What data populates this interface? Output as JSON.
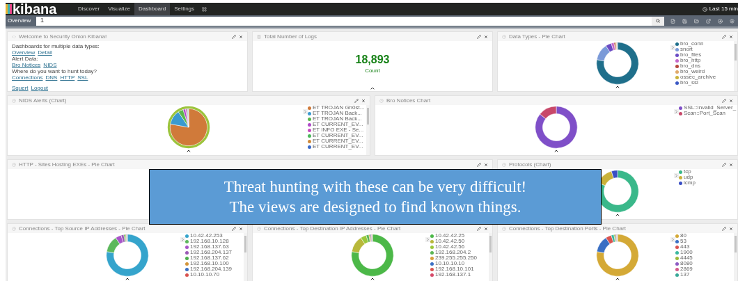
{
  "navbar": {
    "logo": "kibana",
    "tabs": [
      {
        "label": "Discover",
        "selected": false
      },
      {
        "label": "Visualize",
        "selected": false
      },
      {
        "label": "Dashboard",
        "selected": true
      },
      {
        "label": "Settings",
        "selected": false
      }
    ],
    "time": "Last 15 min"
  },
  "query_bar": {
    "tab": "Overview",
    "value": "1"
  },
  "rows": [
    {
      "panels": [
        {
          "kind": "markdown",
          "title": "Welcome to Security Onion Kibana!",
          "lines": [
            {
              "kind": "text",
              "parts": [
                "Dashboards for multiple data types:"
              ]
            },
            {
              "kind": "links",
              "parts": [
                "Overview",
                "Detail"
              ]
            },
            {
              "kind": "text",
              "parts": [
                "Alert Data:"
              ]
            },
            {
              "kind": "links",
              "parts": [
                "Bro Notices",
                "NIDS"
              ]
            },
            {
              "kind": "text",
              "parts": [
                "Where do you want to hunt today?"
              ]
            },
            {
              "kind": "links",
              "parts": [
                "Connections",
                "DNS",
                "HTTP",
                "SSL"
              ]
            },
            {
              "kind": "gap"
            },
            {
              "kind": "links",
              "parts": [
                "Squert",
                "Logout"
              ]
            }
          ]
        },
        {
          "kind": "metric",
          "title": "Total Number of Logs",
          "value": "18,893",
          "label": "Count"
        },
        {
          "kind": "donut",
          "title": "Data Types - Pie Chart",
          "legend": [
            {
              "label": "bro_conn",
              "color": "#1f6f8b"
            },
            {
              "label": "snort",
              "color": "#7b9ad8"
            },
            {
              "label": "bro_files",
              "color": "#6a4bc4"
            },
            {
              "label": "bro_http",
              "color": "#c566c9"
            },
            {
              "label": "bro_dns",
              "color": "#b5483a"
            },
            {
              "label": "bro_weird",
              "color": "#e0a96a"
            },
            {
              "label": "ossec_archive",
              "color": "#c9b23a"
            },
            {
              "label": "bro_ssl",
              "color": "#3a58c4"
            }
          ]
        }
      ]
    },
    {
      "panels": [
        {
          "kind": "pie",
          "title": "NIDS Alerts (Chart)",
          "legend": [
            {
              "label": "ET TROJAN Gh0st...",
              "color": "#d07a3a"
            },
            {
              "label": "ET TROJAN Back...",
              "color": "#3a9ad0"
            },
            {
              "label": "ET TROJAN Back...",
              "color": "#5ab84a"
            },
            {
              "label": "ET CURRENT_EV...",
              "color": "#b04ac8"
            },
            {
              "label": "ET INFO EXE - Se...",
              "color": "#c84ac0"
            },
            {
              "label": "ET CURRENT_EV...",
              "color": "#4ab85a"
            },
            {
              "label": "ET CURRENT_EV...",
              "color": "#d08a3a"
            },
            {
              "label": "ET CURRENT_EV...",
              "color": "#3a6ac8"
            }
          ]
        },
        {
          "kind": "donut",
          "title": "Bro Notices Chart",
          "legend": [
            {
              "label": "SSL::Invalid_Server_",
              "color": "#7f4fc8"
            },
            {
              "label": "Scan::Port_Scan",
              "color": "#c8486a"
            }
          ]
        }
      ]
    },
    {
      "panels": [
        {
          "kind": "empty",
          "title": "HTTP - Sites Hosting EXEs - Pie Chart"
        },
        {
          "kind": "donut",
          "title": "Protocols (Chart)",
          "legend": [
            {
              "label": "tcp",
              "color": "#3ab88a"
            },
            {
              "label": "udp",
              "color": "#c9b23a"
            },
            {
              "label": "icmp",
              "color": "#3a4fc4"
            }
          ]
        }
      ]
    },
    {
      "panels": [
        {
          "kind": "donut",
          "title": "Connections - Top Source IP Addresses - Pie Chart",
          "legend": [
            {
              "label": "10.42.42.253",
              "color": "#35a4cc"
            },
            {
              "label": "192.168.10.128",
              "color": "#5cb85c"
            },
            {
              "label": "192.168.137.63",
              "color": "#a855c8"
            },
            {
              "label": "192.168.204.137",
              "color": "#9b59b6"
            },
            {
              "label": "192.168.137.62",
              "color": "#4cae4c"
            },
            {
              "label": "192.168.10.100",
              "color": "#d4953a"
            },
            {
              "label": "192.168.204.139",
              "color": "#3a6fc4"
            },
            {
              "label": "10.10.10.70",
              "color": "#d9534f"
            }
          ]
        },
        {
          "kind": "donut",
          "title": "Connections - Top Destination IP Addresses - Pie Chart",
          "legend": [
            {
              "label": "10.42.42.25",
              "color": "#4cb848"
            },
            {
              "label": "10.42.42.50",
              "color": "#b8b83a"
            },
            {
              "label": "10.42.42.56",
              "color": "#9ac83a"
            },
            {
              "label": "192.168.204.2",
              "color": "#5ab552"
            },
            {
              "label": "239.255.255.250",
              "color": "#d69e3a"
            },
            {
              "label": "10.10.10.10",
              "color": "#3a6fc4"
            },
            {
              "label": "192.168.10.101",
              "color": "#d9534f"
            },
            {
              "label": "192.168.137.1",
              "color": "#d64a6a"
            }
          ]
        },
        {
          "kind": "donut",
          "title": "Connections - Top Destination Ports - Pie Chart",
          "legend": [
            {
              "label": "80",
              "color": "#d4a936"
            },
            {
              "label": "53",
              "color": "#3a6fc4"
            },
            {
              "label": "443",
              "color": "#d9534f"
            },
            {
              "label": "1900",
              "color": "#3ab8a0"
            },
            {
              "label": "4445",
              "color": "#9cb83a"
            },
            {
              "label": "8080",
              "color": "#8e5bc4"
            },
            {
              "label": "2869",
              "color": "#d45a8a"
            },
            {
              "label": "137",
              "color": "#3aa898"
            }
          ]
        }
      ]
    }
  ],
  "callout": {
    "lines": [
      "Threat hunting with these can be very difficult!",
      "The views are designed to find known things."
    ]
  }
}
